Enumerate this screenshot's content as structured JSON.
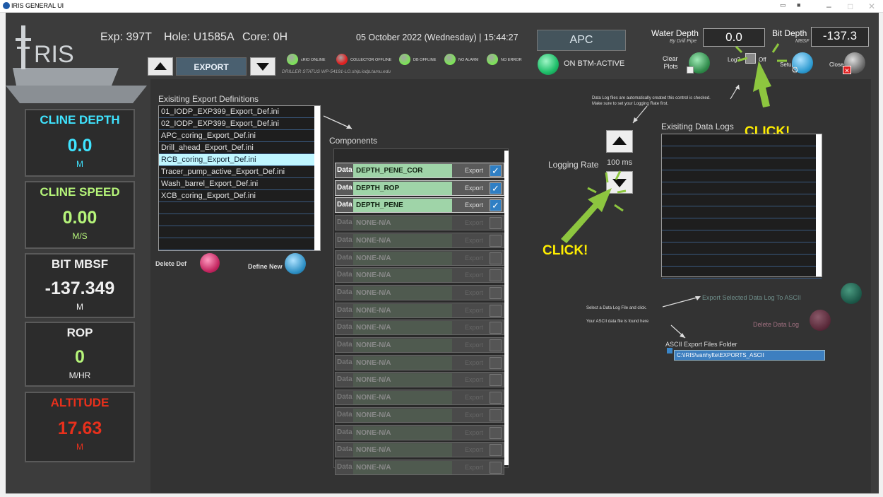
{
  "window": {
    "title": "IRIS GENERAL UI"
  },
  "header": {
    "exp": "Exp: 397T",
    "hole": "Hole: U1585A",
    "core": "Core: 0H",
    "datetime": "05 October 2022 (Wednesday) | 15:44:27",
    "mode": "APC",
    "nav_label": "EXPORT",
    "driller_status": "DRILLER STATUS WP-54191-LO.ship.iodp.tamu.edu",
    "water_depth_label": "Water Depth",
    "water_depth_sub": "By Drill Pipe",
    "water_depth_value": "0.0",
    "bit_depth_label": "Bit Depth",
    "bit_depth_sub": "MBSF",
    "bit_depth_value": "-137.3",
    "btm_status": "ON BTM-ACTIVE",
    "leds": [
      {
        "label": "cRIO ONLINE",
        "color": "#7ee05a"
      },
      {
        "label": "COLLECTOR OFFLINE",
        "color": "#e02020"
      },
      {
        "label": "DB OFFLINE",
        "color": "#7ee05a"
      },
      {
        "label": "NO ALARM",
        "color": "#7ee05a"
      },
      {
        "label": "NO ERROR",
        "color": "#7ee05a"
      }
    ],
    "clear_plots": "Clear\nPlots",
    "log_label": "Log?",
    "log_off": "Off",
    "setup": "Setup",
    "close": "Close"
  },
  "sidebar": {
    "cline_depth": {
      "label": "CLINE DEPTH",
      "value": "0.0",
      "unit": "M"
    },
    "cline_speed": {
      "label": "CLINE SPEED",
      "value": "0.00",
      "unit": "M/S"
    },
    "bit_mbsf": {
      "label": "BIT MBSF",
      "value": "-137.349",
      "unit": "M"
    },
    "rop": {
      "label": "ROP",
      "value": "0",
      "unit": "M/HR"
    },
    "altitude": {
      "label": "ALTITUDE",
      "value": "17.63",
      "unit": "M"
    }
  },
  "export_defs": {
    "title": "Exisiting Export Definitions",
    "items": [
      "01_IODP_EXP399_Export_Def.ini",
      "02_IODP_EXP399_Export_Def.ini",
      "APC_coring_Export_Def.ini",
      "Drill_ahead_Export_Def.ini",
      "RCB_coring_Export_Def.ini",
      "Tracer_pump_active_Export_Def.ini",
      "Wash_barrel_Export_Def.ini",
      "XCB_coring_Export_Def.ini"
    ],
    "delete_label": "Delete Def",
    "define_label": "Define New"
  },
  "components": {
    "title": "Components",
    "data_label": "Data",
    "export_label": "Export",
    "rows": [
      "DEPTH_PENE_COR",
      "DEPTH_ROP",
      "DEPTH_PENE",
      "NONE-N/A",
      "NONE-N/A",
      "NONE-N/A",
      "NONE-N/A",
      "NONE-N/A",
      "NONE-N/A",
      "NONE-N/A",
      "NONE-N/A",
      "NONE-N/A",
      "NONE-N/A",
      "NONE-N/A",
      "NONE-N/A",
      "NONE-N/A",
      "NONE-N/A",
      "NONE-N/A"
    ]
  },
  "logging": {
    "label": "Logging Rate",
    "value": "100 ms",
    "note1": "Data Log files are automatically created this control is checked.",
    "note2": "Make sure to set your Logging Rate first."
  },
  "data_logs": {
    "title": "Exisiting Data Logs",
    "export_btn": "Export Selected Data Log To ASCII",
    "delete_btn": "Delete Data Log",
    "select_note": "Select  a Data Log File and click.",
    "found_note": "Your ASCII data file is found here",
    "folder_label": "ASCII Export Files Folder",
    "folder_path": "C:\\IRIS\\vanhyfte\\EXPORTS_ASCII"
  },
  "annotations": {
    "click1": "CLICK!",
    "click2": "CLICK!"
  }
}
